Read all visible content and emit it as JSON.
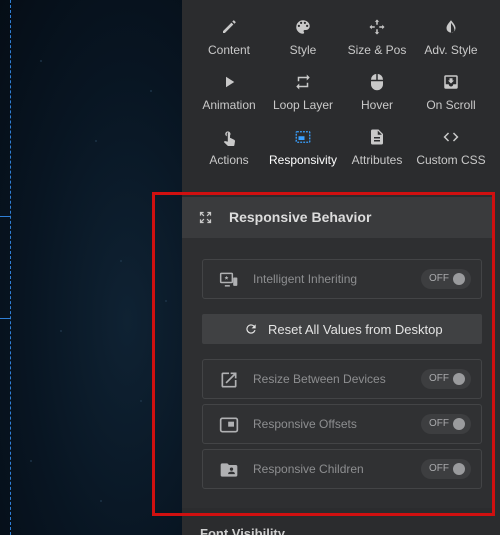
{
  "tabs": [
    {
      "label": "Content",
      "icon": "pencil-icon"
    },
    {
      "label": "Style",
      "icon": "palette-icon"
    },
    {
      "label": "Size & Pos",
      "icon": "move-arrows-icon"
    },
    {
      "label": "Adv. Style",
      "icon": "contrast-icon"
    },
    {
      "label": "Animation",
      "icon": "play-icon"
    },
    {
      "label": "Loop Layer",
      "icon": "loop-icon"
    },
    {
      "label": "Hover",
      "icon": "mouse-icon"
    },
    {
      "label": "On Scroll",
      "icon": "scroll-download-icon"
    },
    {
      "label": "Actions",
      "icon": "touch-icon"
    },
    {
      "label": "Responsivity",
      "icon": "responsive-screen-icon",
      "active": true
    },
    {
      "label": "Attributes",
      "icon": "document-icon"
    },
    {
      "label": "Custom CSS",
      "icon": "code-brackets-icon"
    }
  ],
  "section": {
    "title": "Responsive Behavior",
    "icon": "expand-icon"
  },
  "rows": {
    "intelligent_inheriting": {
      "label": "Intelligent Inheriting",
      "state": "OFF",
      "icon": "monitor-star-icon"
    },
    "reset": {
      "label": "Reset All Values from Desktop",
      "icon": "refresh-icon"
    },
    "resize_between_devices": {
      "label": "Resize Between Devices",
      "state": "OFF",
      "icon": "open-external-icon"
    },
    "responsive_offsets": {
      "label": "Responsive Offsets",
      "state": "OFF",
      "icon": "picture-in-picture-icon"
    },
    "responsive_children": {
      "label": "Responsive Children",
      "state": "OFF",
      "icon": "folder-user-icon"
    }
  },
  "next_section": {
    "title": "Font Visibility"
  },
  "colors": {
    "accent": "#d01010",
    "active_tab_icon": "#3aa0ff"
  }
}
